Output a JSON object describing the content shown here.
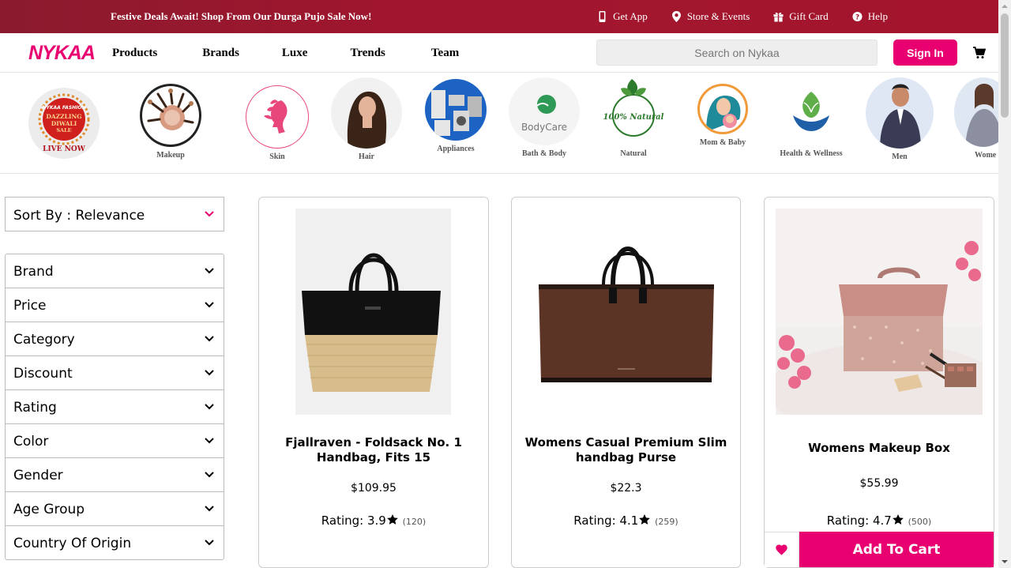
{
  "topbar": {
    "promo": "Festive Deals Await! Shop From Our Durga Pujo Sale Now!",
    "links": [
      {
        "label": "Get App",
        "icon": "phone-icon"
      },
      {
        "label": "Store & Events",
        "icon": "location-pin-icon"
      },
      {
        "label": "Gift Card",
        "icon": "gift-icon"
      },
      {
        "label": "Help",
        "icon": "help-icon"
      }
    ]
  },
  "header": {
    "logo": "NYKAA",
    "nav": [
      "Products",
      "Brands",
      "Luxe",
      "Trends",
      "Team"
    ],
    "search_placeholder": "Search on Nykaa",
    "signin_label": "Sign In"
  },
  "categories": {
    "live_badge": {
      "brand": "NYKAA FASHION",
      "line1": "DAZZLING",
      "line2": "DIWALI",
      "line3": "SALE",
      "cta": "LIVE NOW"
    },
    "items": [
      "Makeup",
      "Skin",
      "Hair",
      "Appliances",
      "Bath & Body",
      "Natural",
      "Mom & Baby",
      "Health & Wellness",
      "Men",
      "Wome"
    ],
    "bodycare_text": "BodyCare",
    "natural_text": "100% Natural"
  },
  "sidebar": {
    "sort_label": "Sort By : Relevance",
    "filters": [
      "Brand",
      "Price",
      "Category",
      "Discount",
      "Rating",
      "Color",
      "Gender",
      "Age Group",
      "Country Of Origin"
    ]
  },
  "products": [
    {
      "title": "Fjallraven - Foldsack No. 1 Handbag, Fits 15",
      "price": "$109.95",
      "rating_label": "Rating: 3.9",
      "count": "(120)"
    },
    {
      "title": "Womens Casual Premium Slim handbag Purse",
      "price": "$22.3",
      "rating_label": "Rating: 4.1",
      "count": "(259)"
    },
    {
      "title": "Womens Makeup Box",
      "price": "$55.99",
      "rating_label": "Rating: 4.7",
      "count": "(500)",
      "add_to_cart": "Add To Cart"
    }
  ],
  "colors": {
    "brand_pink": "#e80071",
    "banner": "#a0162e"
  }
}
